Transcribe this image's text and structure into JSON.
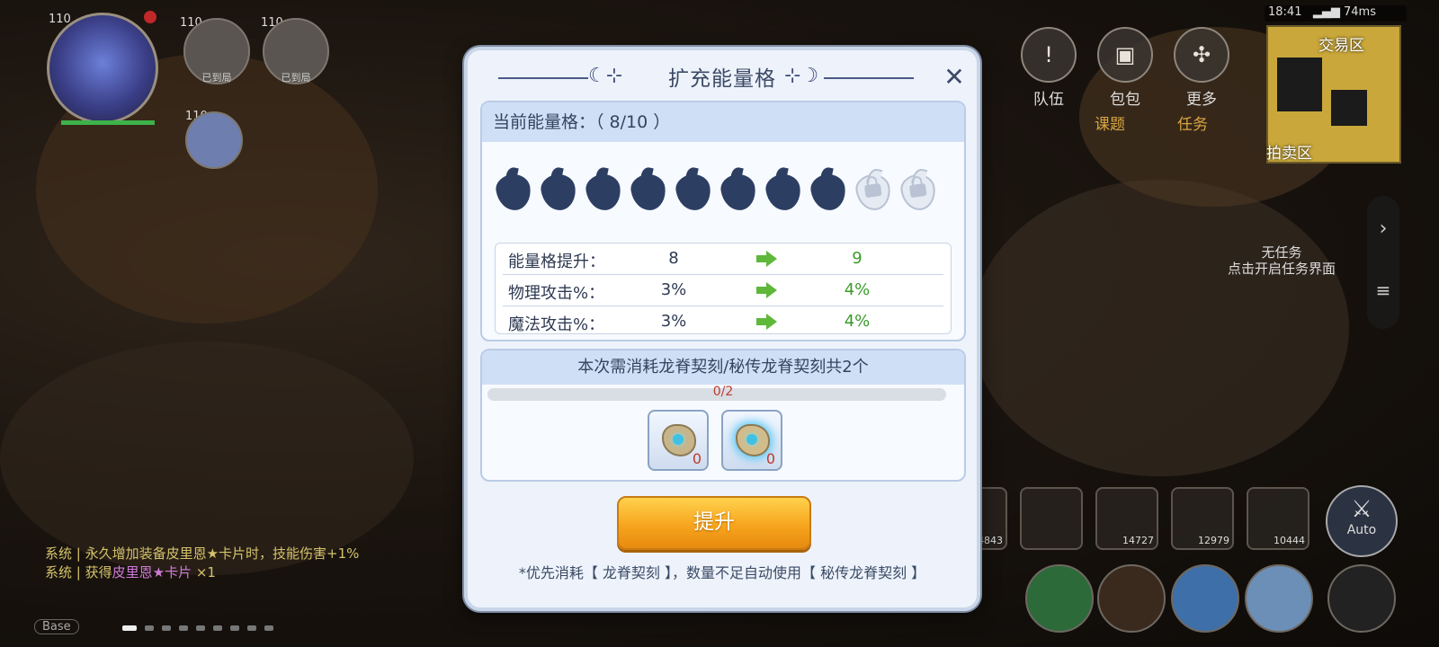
{
  "hud": {
    "player_level": "110",
    "party_levels": [
      "110",
      "110",
      "110"
    ],
    "party_status": [
      "已到局",
      "已到局"
    ],
    "top_menu": [
      {
        "label": "队伍",
        "icon": "team-icon"
      },
      {
        "label": "包包",
        "icon": "bag-icon"
      },
      {
        "label": "更多",
        "icon": "more-icon"
      }
    ],
    "sub_menu": [
      {
        "label": "课题",
        "icon": "book-icon"
      },
      {
        "label": "任务",
        "icon": "quest-icon"
      }
    ],
    "status_bar": {
      "time": "18:41",
      "ping": "74ms"
    },
    "minimap": {
      "zone_top": "交易区",
      "zone_bottom": "拍卖区"
    },
    "quest_hint": [
      "无任务",
      "点击开启任务界面"
    ],
    "skill_counts": [
      "4843",
      "",
      "14727",
      "12979",
      "10444"
    ],
    "auto_label": "Auto",
    "chat": [
      {
        "channel": "系统",
        "text": "永久增加装备皮里恩★卡片时，技能伤害+1%"
      },
      {
        "channel": "系统",
        "text": "获得",
        "item": "皮里恩★卡片",
        "qty": "×1"
      }
    ],
    "chat_channel": "Base"
  },
  "modal": {
    "title": "扩充能量格",
    "close": "✕",
    "current_label": "当前能量格：（ 8/10 ）",
    "slots": {
      "filled": 8,
      "total": 10
    },
    "stats": [
      {
        "label": "能量格提升：",
        "from": "8",
        "to": "9"
      },
      {
        "label": "物理攻击%：",
        "from": "3%",
        "to": "4%"
      },
      {
        "label": "魔法攻击%：",
        "from": "3%",
        "to": "4%"
      }
    ],
    "cost_title": "本次需消耗龙脊契刻/秘传龙脊契刻共2个",
    "progress": {
      "text": "0/2",
      "fraction": 0
    },
    "items": [
      {
        "name": "龙脊契刻",
        "count": "0"
      },
      {
        "name": "秘传龙脊契刻",
        "count": "0"
      }
    ],
    "upgrade_button": "提升",
    "footnote": "*优先消耗【 龙脊契刻 】，数量不足自动使用【 秘传龙脊契刻 】"
  },
  "colors": {
    "accent_orange": "#f7a51e",
    "energy_filled": "#2d3e63",
    "increase_green": "#3c9a2a",
    "progress_red": "#c0392b"
  }
}
